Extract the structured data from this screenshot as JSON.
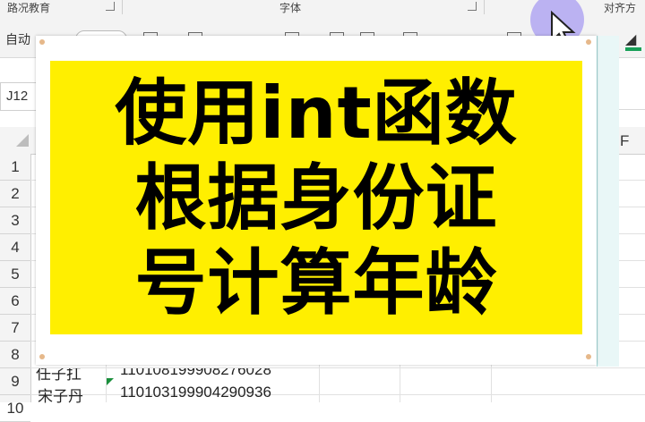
{
  "ribbon": {
    "groups": [
      "路况教育",
      "字体",
      "对齐方"
    ],
    "autofill_label": "自动"
  },
  "name_box": "J12",
  "column_header_visible": "F",
  "rows": [
    "1",
    "2",
    "3",
    "4",
    "5",
    "6",
    "7",
    "8",
    "9",
    "10"
  ],
  "visible_cells": [
    {
      "row": "9",
      "name": "任子扛",
      "id": "110108199908276028"
    },
    {
      "row": "10",
      "name": "宋子丹",
      "id": "110103199904290936"
    }
  ],
  "title_card": {
    "lines": [
      "使用int函数",
      "根据身份证",
      "号计算年龄"
    ],
    "background_color": "#ffef00",
    "text_color": "#000000"
  },
  "icons": [
    "mouse-cursor-icon",
    "fill-color-icon"
  ]
}
